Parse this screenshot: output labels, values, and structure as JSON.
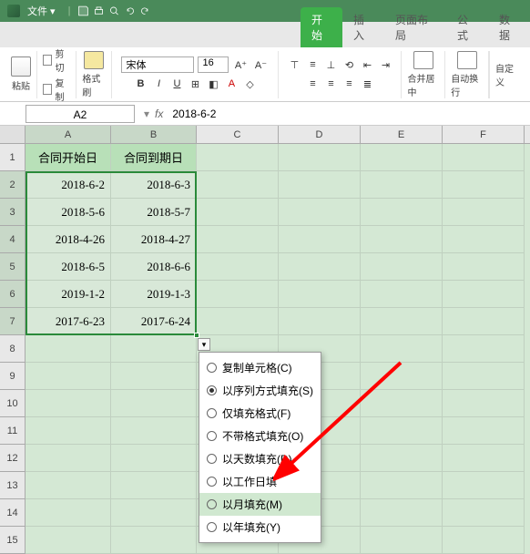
{
  "menubar": {
    "file": "文件"
  },
  "tabs": {
    "start": "开始",
    "insert": "插入",
    "page_layout": "页面布局",
    "formulas": "公式",
    "data": "数据"
  },
  "ribbon": {
    "paste": "粘贴",
    "cut": "剪切",
    "copy": "复制",
    "format_painter": "格式刷",
    "font_name": "宋体",
    "font_size": "16",
    "merge_center": "合并居中",
    "wrap_text": "自动换行",
    "custom": "自定义"
  },
  "formula_bar": {
    "cell_ref": "A2",
    "value": "2018-6-2"
  },
  "columns": [
    "A",
    "B",
    "C",
    "D",
    "E",
    "F"
  ],
  "rows": [
    "1",
    "2",
    "3",
    "4",
    "5",
    "6",
    "7",
    "8",
    "9",
    "10",
    "11",
    "12",
    "13",
    "14",
    "15"
  ],
  "table": {
    "headers": [
      "合同开始日",
      "合同到期日"
    ],
    "data": [
      [
        "2018-6-2",
        "2018-6-3"
      ],
      [
        "2018-5-6",
        "2018-5-7"
      ],
      [
        "2018-4-26",
        "2018-4-27"
      ],
      [
        "2018-6-5",
        "2018-6-6"
      ],
      [
        "2019-1-2",
        "2019-1-3"
      ],
      [
        "2017-6-23",
        "2017-6-24"
      ]
    ]
  },
  "autofill_menu": {
    "copy_cells": "复制单元格(C)",
    "fill_series": "以序列方式填充(S)",
    "fill_format_only": "仅填充格式(F)",
    "fill_without_format": "不带格式填充(O)",
    "fill_days": "以天数填充(D)",
    "fill_workdays": "以工作日填",
    "fill_months": "以月填充(M)",
    "fill_years": "以年填充(Y)"
  }
}
